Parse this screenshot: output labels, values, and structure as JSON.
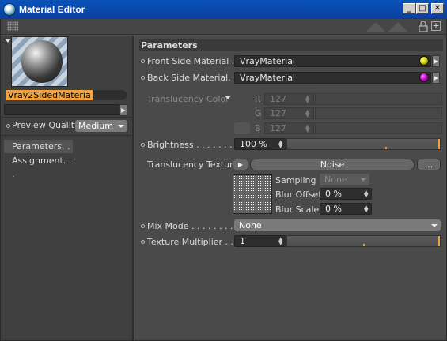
{
  "window": {
    "title": "Material Editor",
    "min_label": "_",
    "max_label": "□",
    "close_label": "✕"
  },
  "toolbar": {
    "expand_label": "+"
  },
  "left": {
    "material_name": "Vray2SidedMateria",
    "preview_quality_label": "Preview Quality",
    "preview_quality_value": "Medium",
    "nav": [
      {
        "label": "Parameters. . ."
      },
      {
        "label": "Assignment. . ."
      }
    ]
  },
  "params": {
    "header": "Parameters",
    "front_side_material": {
      "label": "Front Side Material . . .",
      "value": "VrayMaterial",
      "swatch": "#c8c800"
    },
    "back_side_material": {
      "label": "Back Side Material. . . .",
      "value": "VrayMaterial",
      "swatch": "#c000c0"
    },
    "translucency_color": {
      "label": "Translucency Color",
      "r_label": "R",
      "g_label": "G",
      "b_label": "B",
      "r": "127",
      "g": "127",
      "b": "127"
    },
    "brightness": {
      "label": "Brightness . . . . . . . . . .",
      "value": "100 %",
      "fraction": 1.0
    },
    "translucency_texture": {
      "label": "Translucency Texture",
      "texture": "Noise",
      "more_label": "...",
      "sampling_label": "Sampling",
      "sampling_value": "None",
      "blur_offset_label": "Blur Offset",
      "blur_offset_value": "0 %",
      "blur_scale_label": "Blur Scale",
      "blur_scale_value": "0 %"
    },
    "mix_mode": {
      "label": "Mix Mode . . . . . . . . . . .",
      "value": "None"
    },
    "texture_multiplier": {
      "label": "Texture Multiplier . . . .",
      "value": "1"
    }
  },
  "colors": {
    "accent": "#f2a23c",
    "titlebar": "#0a4ab0"
  }
}
